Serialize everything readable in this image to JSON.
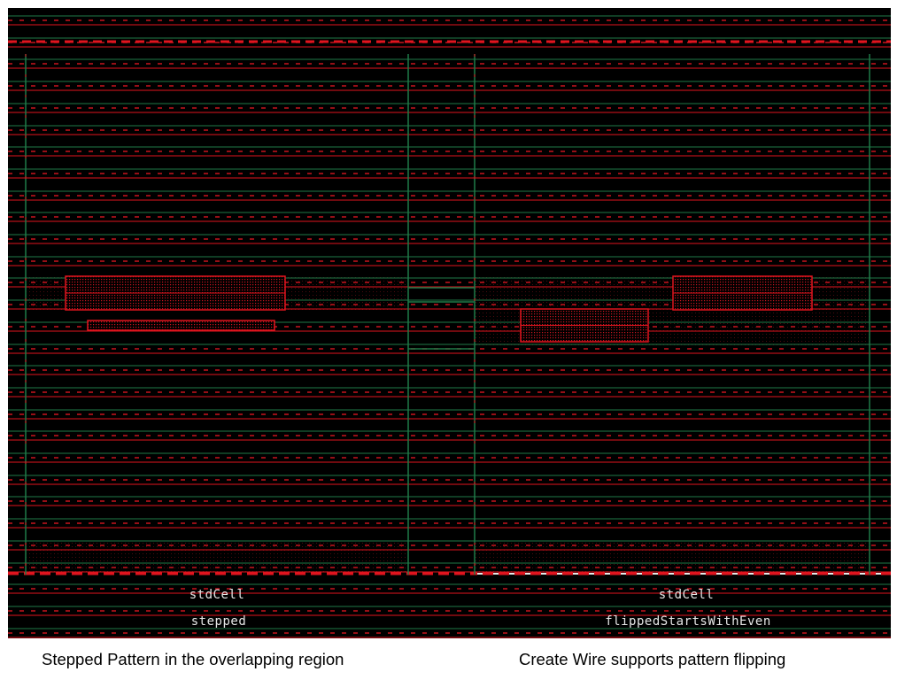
{
  "layout_view": {
    "colors": {
      "background": "#000000",
      "wire": "#e0141e",
      "dash": "#c8141e",
      "boundary": "#1f7a48",
      "fill_dots": "#d01820"
    },
    "left_cell": {
      "cell_name": "stdCell",
      "instance_name": "stepped"
    },
    "right_cell": {
      "cell_name": "stdCell",
      "instance_name": "flippedStartsWithEven"
    }
  },
  "captions": {
    "left": "Stepped Pattern in the overlapping region",
    "right": "Create Wire supports pattern flipping"
  }
}
